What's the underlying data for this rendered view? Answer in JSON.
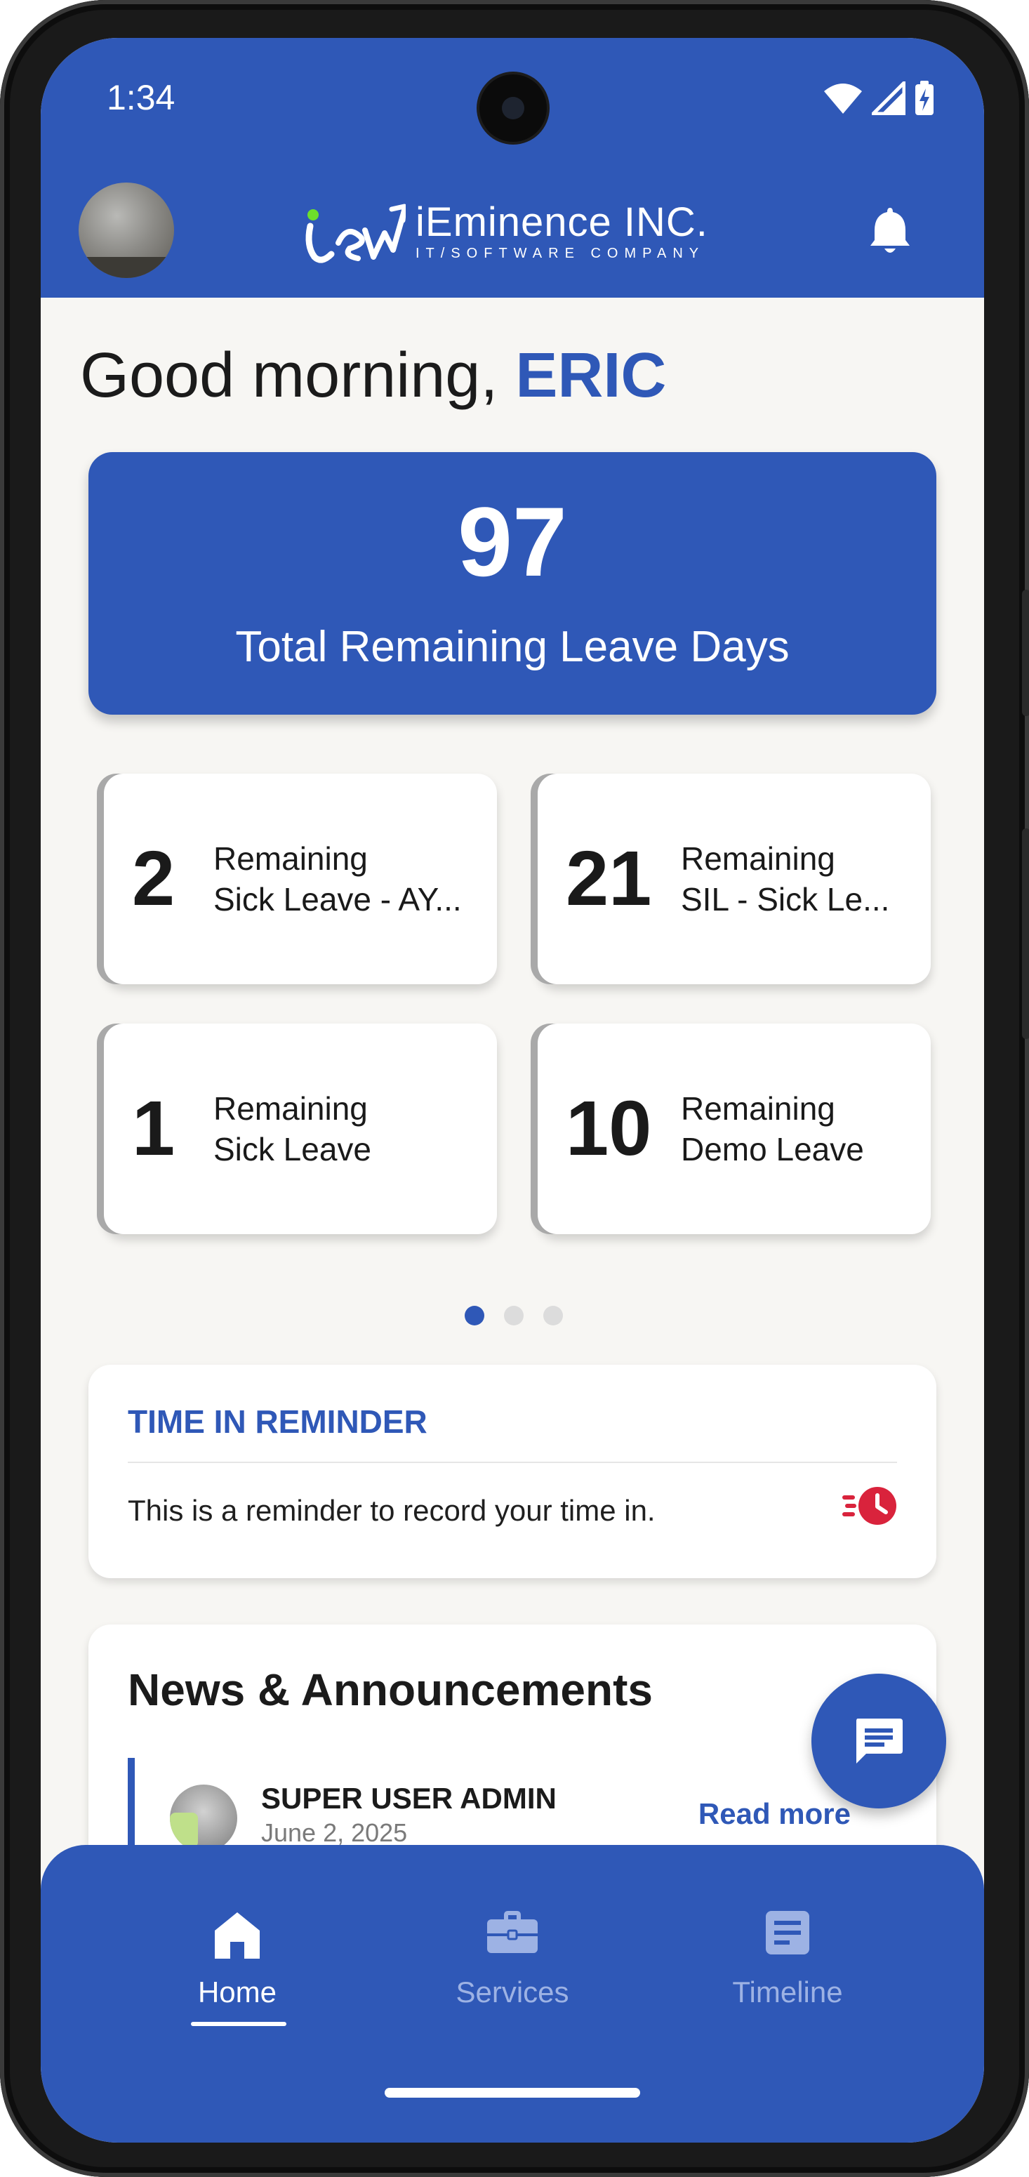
{
  "status_bar": {
    "time": "1:34",
    "icons": [
      "wifi-icon",
      "signal-icon",
      "battery-charging-icon"
    ]
  },
  "header": {
    "logo_name": "iEminence INC.",
    "logo_tagline": "IT/SOFTWARE COMPANY",
    "icons": [
      "avatar",
      "bell-icon"
    ]
  },
  "greeting": {
    "prefix": "Good morning, ",
    "name": "ERIC"
  },
  "total_leave": {
    "value": "97",
    "label": "Total Remaining Leave Days"
  },
  "leave_cards": [
    {
      "value": "2",
      "line1": "Remaining",
      "line2": "Sick Leave - AY..."
    },
    {
      "value": "21",
      "line1": "Remaining",
      "line2": "SIL - Sick Le..."
    },
    {
      "value": "1",
      "line1": "Remaining",
      "line2": "Sick Leave"
    },
    {
      "value": "10",
      "line1": "Remaining",
      "line2": "Demo Leave"
    }
  ],
  "carousel": {
    "page_count": 3,
    "active_index": 0
  },
  "reminder": {
    "title": "TIME IN REMINDER",
    "text": "This is a reminder to record your time in.",
    "icon": "clock-fast-icon",
    "icon_color": "#d9233c"
  },
  "news": {
    "title": "News & Announcements",
    "items": [
      {
        "author": "SUPER USER ADMIN",
        "date": "June 2, 2025",
        "action": "Read more"
      }
    ]
  },
  "fab": {
    "icon": "chat-icon"
  },
  "bottom_nav": {
    "items": [
      {
        "label": "Home",
        "icon": "home-icon",
        "active": true
      },
      {
        "label": "Services",
        "icon": "briefcase-icon",
        "active": false
      },
      {
        "label": "Timeline",
        "icon": "document-icon",
        "active": false
      }
    ]
  },
  "colors": {
    "brand": "#2f58b7",
    "background": "#f7f6f3",
    "alert": "#d9233c"
  }
}
